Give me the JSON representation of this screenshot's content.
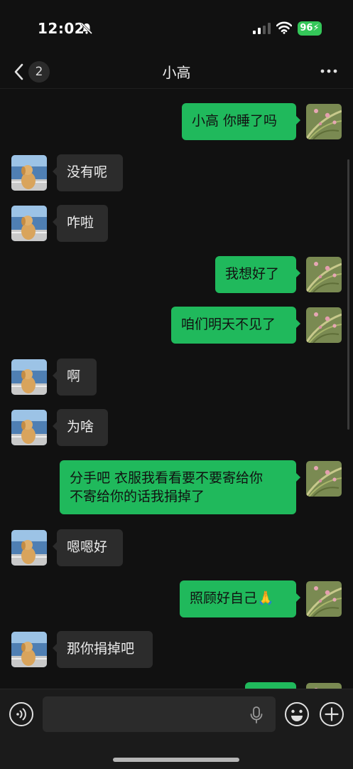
{
  "status_bar": {
    "time": "12:02",
    "battery": "96"
  },
  "nav": {
    "unread_count": "2",
    "title": "小高"
  },
  "messages": [
    {
      "side": "out",
      "text": "小高 你睡了吗"
    },
    {
      "side": "in",
      "text": "没有呢"
    },
    {
      "side": "in",
      "text": "咋啦"
    },
    {
      "side": "out",
      "text": "我想好了"
    },
    {
      "side": "out",
      "text": "咱们明天不见了"
    },
    {
      "side": "in",
      "text": "啊"
    },
    {
      "side": "in",
      "text": "为啥"
    },
    {
      "side": "out",
      "text": "分手吧 衣服我看看要不要寄给你\n不寄给你的话我捐掉了"
    },
    {
      "side": "in",
      "text": "嗯嗯好"
    },
    {
      "side": "out",
      "text": "照顾好自己🙏"
    },
    {
      "side": "in",
      "text": "那你捐掉吧"
    },
    {
      "side": "out",
      "text": ""
    }
  ],
  "colors": {
    "background": "#111111",
    "outgoing_bubble": "#20b95c",
    "incoming_bubble": "#2c2c2c",
    "battery": "#34c759"
  },
  "icons": [
    "mute-bell-icon",
    "signal-icon",
    "wifi-icon",
    "back-chevron-icon",
    "more-dots-icon",
    "voice-icon",
    "microphone-icon",
    "emoji-icon",
    "plus-icon"
  ]
}
